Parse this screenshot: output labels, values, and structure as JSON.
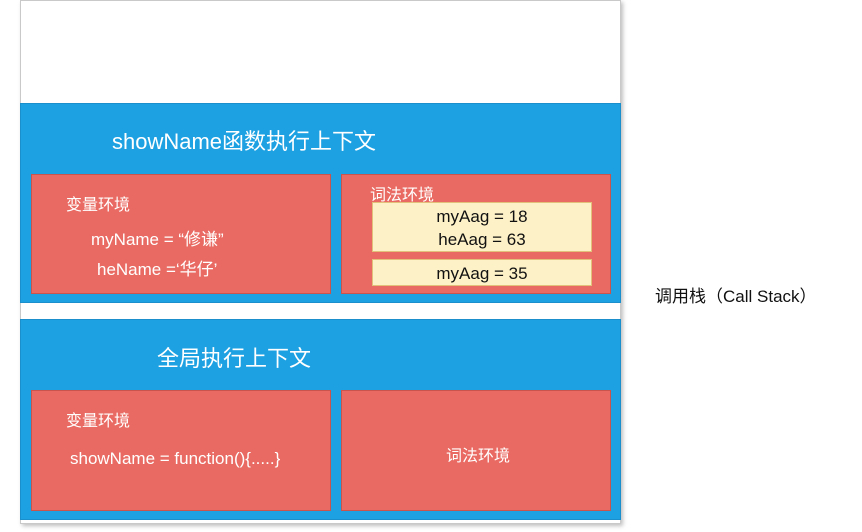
{
  "call_stack_label": "调用栈（Call Stack）",
  "frames": {
    "show_name": {
      "title": "showName函数执行上下文",
      "variable_env": {
        "label": "变量环境",
        "lines": [
          "myName = “修谦”",
          "heName =‘华仔’"
        ]
      },
      "lexical_env": {
        "label": "词法环境",
        "blocks": [
          {
            "lines": [
              "myAag = 18",
              "heAag = 63"
            ]
          },
          {
            "lines": [
              "myAag = 35"
            ]
          }
        ]
      }
    },
    "global": {
      "title": "全局执行上下文",
      "variable_env": {
        "label": "变量环境",
        "lines": [
          "showName = function(){.....}"
        ]
      },
      "lexical_env": {
        "label": "词法环境"
      }
    }
  },
  "colors": {
    "frame": "#1da1e2",
    "environment": "#e96a62",
    "slot": "#fdf1c7"
  }
}
